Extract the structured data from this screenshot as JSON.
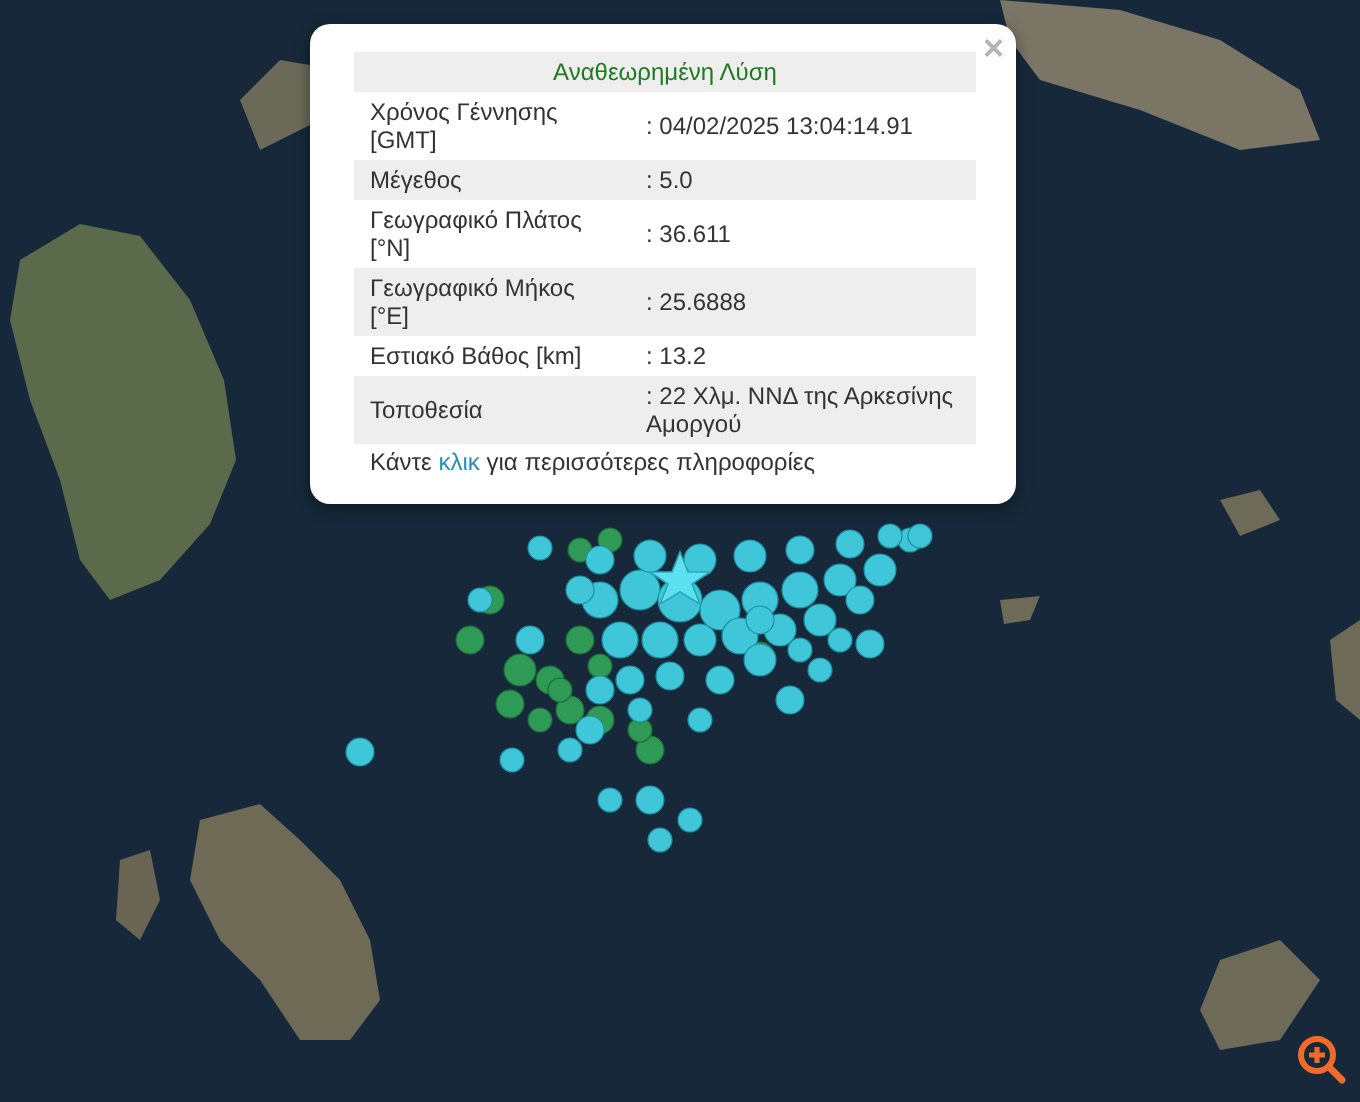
{
  "popup": {
    "title": "Αναθεωρημένη Λύση",
    "close": "×",
    "rows": [
      {
        "label": "Χρόνος Γέννησης [GMT]",
        "value": ": 04/02/2025 13:04:14.91"
      },
      {
        "label": "Μέγεθος",
        "value": ": 5.0"
      },
      {
        "label": "Γεωγραφικό Πλάτος [°N]",
        "value": ": 36.611"
      },
      {
        "label": "Γεωγραφικό Μήκος [°E]",
        "value": ": 25.6888"
      },
      {
        "label": "Εστιακό Βάθος [km]",
        "value": ": 13.2"
      },
      {
        "label": "Τοποθεσία",
        "value": ": 22 Χλμ. ΝΝΔ της Αρκεσίνης Αμοργού"
      }
    ],
    "footer": {
      "before": "Κάντε",
      "link": "κλικ",
      "after": "για περισσότερες πληροφορίες"
    }
  }
}
